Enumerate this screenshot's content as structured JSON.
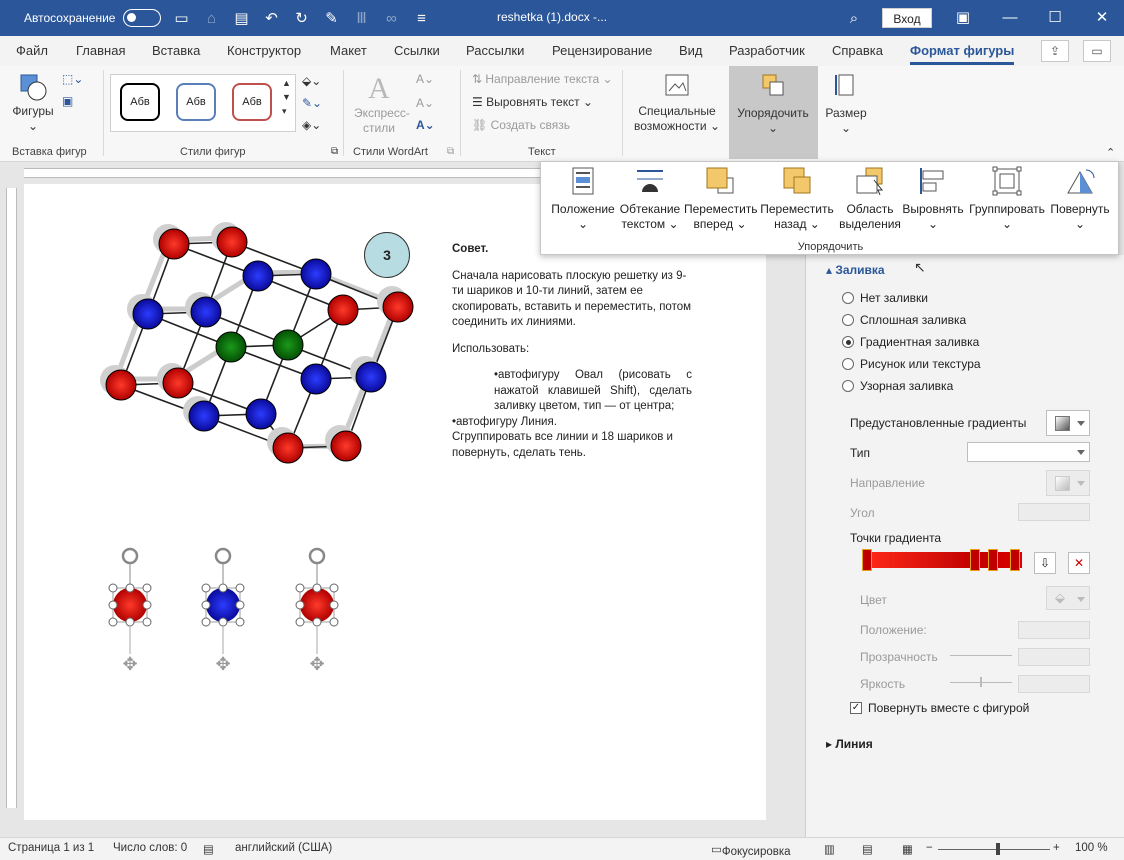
{
  "titlebar": {
    "autosave_label": "Автосохранение",
    "doc_title": "reshetka (1).docx  -...",
    "login_label": "Вход"
  },
  "tabs": [
    "Файл",
    "Главная",
    "Вставка",
    "Конструктор",
    "Макет",
    "Ссылки",
    "Рассылки",
    "Рецензирование",
    "Вид",
    "Разработчик",
    "Справка",
    "Формат фигуры"
  ],
  "ribbon": {
    "shapes_label": "Фигуры",
    "insert_shapes_group": "Вставка фигур",
    "style_sample": "Абв",
    "shape_styles_group": "Стили фигур",
    "express_styles": "Экспресс-стили",
    "wordart_group": "Стили WordArt",
    "text_direction": "Направление текста",
    "align_text": "Выровнять текст",
    "create_link": "Создать связь",
    "text_group": "Текст",
    "accessibility": "Специальные возможности",
    "arrange": "Упорядочить",
    "size": "Размер"
  },
  "arrange_panel": {
    "items": [
      {
        "label1": "Положение",
        "label2": ""
      },
      {
        "label1": "Обтекание",
        "label2": "текстом"
      },
      {
        "label1": "Переместить",
        "label2": "вперед"
      },
      {
        "label1": "Переместить",
        "label2": "назад"
      },
      {
        "label1": "Область",
        "label2": "выделения"
      },
      {
        "label1": "Выровнять",
        "label2": ""
      },
      {
        "label1": "Группировать",
        "label2": ""
      },
      {
        "label1": "Повернуть",
        "label2": ""
      }
    ],
    "group_label": "Упорядочить"
  },
  "document": {
    "number_badge": "3",
    "title": "Совет.",
    "para1": "Сначала нарисовать плоскую решетку из 9-ти шариков и 10-ти линий, затем ее скопировать, вставить и переместить, потом соединить их линиями.",
    "use_label": "Использовать:",
    "bullet1": "•автофигуру Овал (рисовать с нажатой клавишей Shift), сделать заливку цветом, тип — от центра;",
    "bullet2": "•автофигуру Линия.",
    "para2": "Сгруппировать все линии и 18 шариков и повернуть, сделать тень."
  },
  "format_pane": {
    "fill_header": "Заливка",
    "fill_options": [
      "Нет заливки",
      "Сплошная заливка",
      "Градиентная заливка",
      "Рисунок или текстура",
      "Узорная заливка"
    ],
    "selected_fill": "Градиентная заливка",
    "preset_gradients": "Предустановленные градиенты",
    "type": "Тип",
    "direction": "Направление",
    "angle": "Угол",
    "gradient_stops": "Точки градиента",
    "color": "Цвет",
    "position": "Положение:",
    "transparency": "Прозрачность",
    "brightness": "Яркость",
    "rotate_with_shape": "Повернуть вместе с фигурой",
    "line_header": "Линия"
  },
  "statusbar": {
    "page": "Страница 1 из 1",
    "words": "Число слов: 0",
    "language": "английский (США)",
    "focus": "Фокусировка",
    "zoom": "100 %"
  },
  "colors": {
    "accent": "#2b579a",
    "ball_red": "#e00000",
    "ball_blue": "#1010c8",
    "ball_green": "#0a7a0a"
  }
}
